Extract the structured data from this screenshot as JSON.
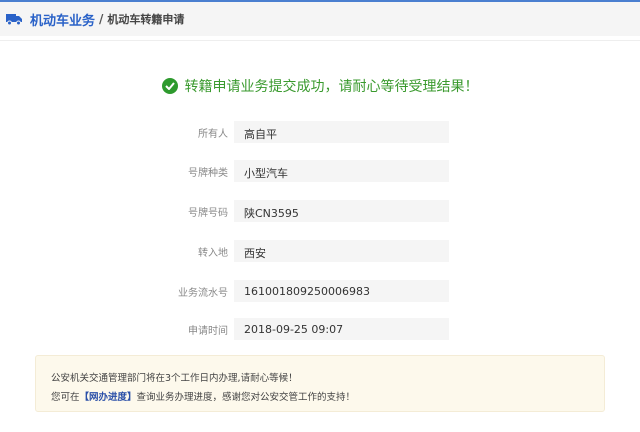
{
  "breadcrumb": {
    "section": "机动车业务",
    "separator": "/",
    "current": "机动车转籍申请"
  },
  "success_message": "转籍申请业务提交成功，请耐心等待受理结果！",
  "fields": [
    {
      "label": "所有人",
      "value": "高自平"
    },
    {
      "label": "号牌种类",
      "value": "小型汽车"
    },
    {
      "label": "号牌号码",
      "value": "陕CN3595"
    },
    {
      "label": "转入地",
      "value": "西安"
    },
    {
      "label": "业务流水号",
      "value": "161001809250006983"
    },
    {
      "label": "申请时间",
      "value": "2018-09-25 09:07"
    }
  ],
  "notice": {
    "line1": "公安机关交通管理部门将在3个工作日内办理,请耐心等候！",
    "line2_prefix": "您可在",
    "link": "【网办进度】",
    "line2_suffix": "查询业务办理进度，感谢您对公安交管工作的支持！"
  },
  "colors": {
    "accent": "#2a62c8",
    "success": "#3a9a2e"
  }
}
